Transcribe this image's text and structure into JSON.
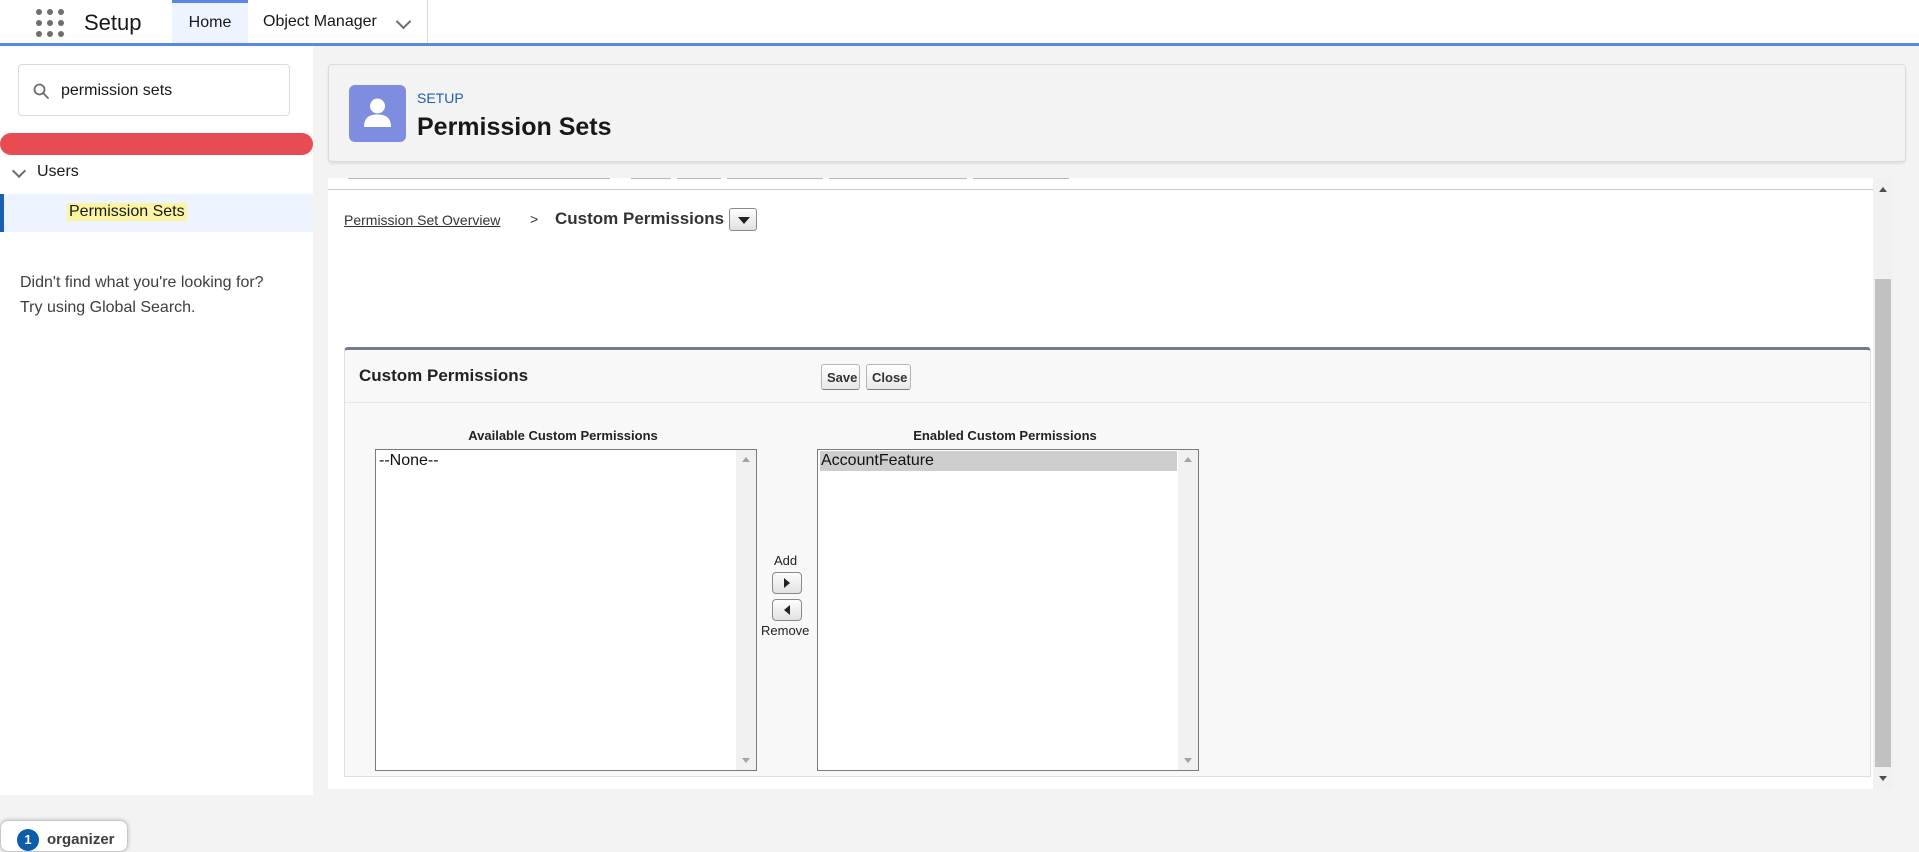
{
  "nav": {
    "app_name": "Setup",
    "tabs": [
      {
        "label": "Home"
      },
      {
        "label": "Object Manager"
      }
    ]
  },
  "sidebar": {
    "search_value": "permission sets",
    "tree": {
      "group_label": "Users",
      "item_label": "Permission Sets"
    },
    "help_line1": "Didn't find what you're looking for?",
    "help_line2": "Try using Global Search."
  },
  "header": {
    "eyebrow": "SETUP",
    "title": "Permission Sets"
  },
  "breadcrumb": {
    "link": "Permission Set Overview",
    "separator": ">",
    "current": "Custom Permissions"
  },
  "panel": {
    "title": "Custom Permissions",
    "save_label": "Save",
    "close_label": "Close",
    "available_label": "Available Custom Permissions",
    "enabled_label": "Enabled Custom Permissions",
    "available_options": [
      "--None--"
    ],
    "enabled_options": [
      "AccountFeature"
    ],
    "add_label": "Add",
    "remove_label": "Remove"
  },
  "badge": {
    "text": "organizer",
    "logo_text": "1"
  },
  "colors": {
    "brand_blue": "#5a86e6",
    "header_icon": "#7f8de1",
    "alert_red": "#e64c52",
    "highlight": "#fbf5a3"
  }
}
